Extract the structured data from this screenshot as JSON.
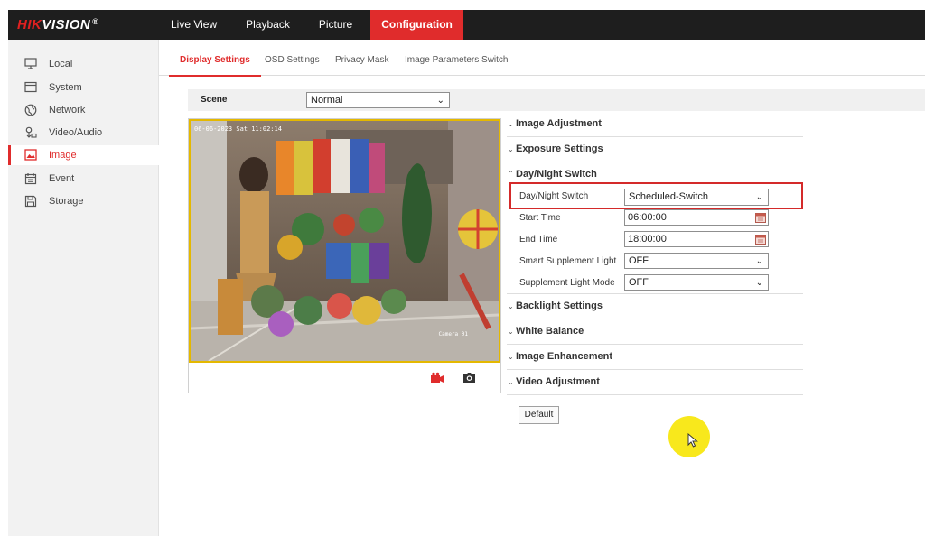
{
  "brand": {
    "part1": "HIK",
    "part2": "VISION",
    "reg": "®"
  },
  "nav": [
    {
      "label": "Live View",
      "active": false
    },
    {
      "label": "Playback",
      "active": false
    },
    {
      "label": "Picture",
      "active": false
    },
    {
      "label": "Configuration",
      "active": true
    }
  ],
  "sidebar": [
    {
      "label": "Local",
      "icon": "monitor-icon",
      "active": false
    },
    {
      "label": "System",
      "icon": "system-icon",
      "active": false
    },
    {
      "label": "Network",
      "icon": "globe-icon",
      "active": false
    },
    {
      "label": "Video/Audio",
      "icon": "audio-video-icon",
      "active": false
    },
    {
      "label": "Image",
      "icon": "image-icon",
      "active": true
    },
    {
      "label": "Event",
      "icon": "calendar-icon",
      "active": false
    },
    {
      "label": "Storage",
      "icon": "storage-icon",
      "active": false
    }
  ],
  "tabs": [
    {
      "label": "Display Settings",
      "active": true
    },
    {
      "label": "OSD Settings",
      "active": false
    },
    {
      "label": "Privacy Mask",
      "active": false
    },
    {
      "label": "Image Parameters Switch",
      "active": false
    }
  ],
  "scene": {
    "label": "Scene",
    "value": "Normal"
  },
  "video": {
    "timestamp": "06-06-2023 Sat 11:02:14",
    "camera_name": "Camera 01"
  },
  "sections": {
    "image_adjustment": "Image Adjustment",
    "exposure": "Exposure Settings",
    "day_night": "Day/Night Switch",
    "backlight": "Backlight Settings",
    "white_balance": "White Balance",
    "image_enhancement": "Image Enhancement",
    "video_adjustment": "Video Adjustment"
  },
  "day_night_fields": {
    "switch_label": "Day/Night Switch",
    "switch_value": "Scheduled-Switch",
    "start_label": "Start Time",
    "start_value": "06:00:00",
    "end_label": "End Time",
    "end_value": "18:00:00",
    "smart_label": "Smart Supplement Light",
    "smart_value": "OFF",
    "mode_label": "Supplement Light Mode",
    "mode_value": "OFF"
  },
  "buttons": {
    "default": "Default"
  },
  "colors": {
    "accent": "#e02c2c",
    "topbar": "#1e1e1e",
    "highlight_cursor": "#f8e81c"
  }
}
